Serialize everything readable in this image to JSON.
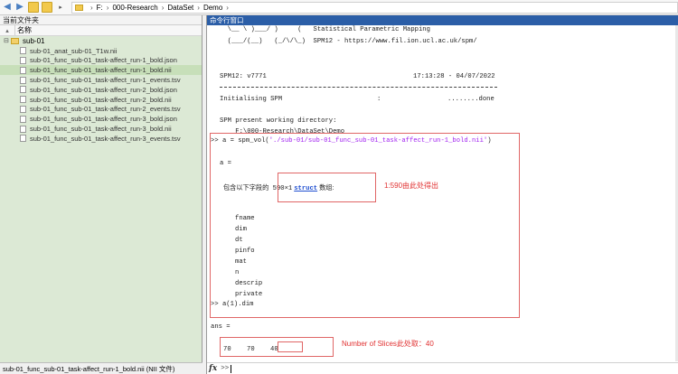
{
  "address": {
    "crumbs": [
      "F:",
      "000-Research",
      "DataSet",
      "Demo"
    ]
  },
  "left_panel": {
    "title": "当前文件夹",
    "column_name": "名称",
    "root_folder": "sub-01",
    "files": [
      "sub-01_anat_sub-01_T1w.nii",
      "sub-01_func_sub-01_task-affect_run-1_bold.json",
      "sub-01_func_sub-01_task-affect_run-1_bold.nii",
      "sub-01_func_sub-01_task-affect_run-1_events.tsv",
      "sub-01_func_sub-01_task-affect_run-2_bold.json",
      "sub-01_func_sub-01_task-affect_run-2_bold.nii",
      "sub-01_func_sub-01_task-affect_run-2_events.tsv",
      "sub-01_func_sub-01_task-affect_run-3_bold.json",
      "sub-01_func_sub-01_task-affect_run-3_bold.nii",
      "sub-01_func_sub-01_task-affect_run-3_events.tsv"
    ],
    "selected_index": 2,
    "status": "sub-01_func_sub-01_task-affect_run-1_bold.nii  (NII 文件)"
  },
  "command_window": {
    "title": "命令行窗口",
    "banner1": "  \\__ \\ )___/ )     (   Statistical Parametric Mapping",
    "banner2": "  (___/(__)   (_/\\/\\_)  SPM12 - https://www.fil.ion.ucl.ac.uk/spm/",
    "version": "SPM12: v7771",
    "timestamp": "17:13:28 - 04/07/2022",
    "init_label": "Initialising SPM",
    "init_colon": ":",
    "init_done": "........done",
    "pwd_label": "SPM present working directory:",
    "pwd_value": "    F:\\000-Research\\DataSet\\Demo",
    "cmd1_prefix": ">> a = spm_vol(",
    "cmd1_string": "'./sub-01/sub-01_func_sub-01_task-affect_run-1_bold.nii'",
    "cmd1_suffix": ")",
    "a_eq": "a =",
    "struct_prefix": "  包含以下字段的",
    "struct_dims": "590×1",
    "struct_word": "struct",
    "struct_suffix": "数组:",
    "fields": [
      "fname",
      "dim",
      "dt",
      "pinfo",
      "mat",
      "n",
      "descrip",
      "private"
    ],
    "cmd2": ">> a(1).dim",
    "ans_eq": "ans =",
    "dim_values": [
      "70",
      "70",
      "40"
    ],
    "prompt": ">>"
  },
  "annotations": {
    "note1": "1:590由此处得出",
    "note2": "Number of Slices此处取：40"
  }
}
